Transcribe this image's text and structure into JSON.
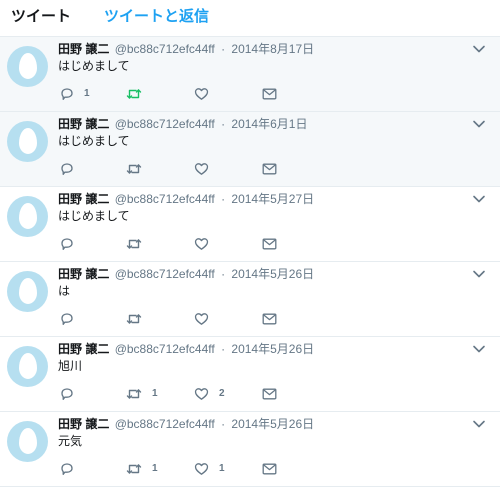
{
  "tabs": {
    "tweets": "ツイート",
    "tweets_replies": "ツイートと返信"
  },
  "colors": {
    "accent": "#1da1f2",
    "retweet_green": "#17bf63",
    "muted": "#657786",
    "highlight_bg": "#f5f8fa",
    "avatar_bg": "#b6dff0"
  },
  "icons": {
    "reply": "reply-icon",
    "retweet": "retweet-icon",
    "like": "heart-icon",
    "dm": "envelope-icon",
    "more": "chevron-down-icon",
    "avatar": "egg-avatar-icon"
  },
  "tweets": [
    {
      "name": "田野 譲二",
      "handle": "@bc88c712efc44ff",
      "sep": "·",
      "date": "2014年8月17日",
      "text": "はじめまして",
      "reply_count": "1",
      "retweet_count": "",
      "like_count": "",
      "highlighted": true,
      "retweeted": true
    },
    {
      "name": "田野 譲二",
      "handle": "@bc88c712efc44ff",
      "sep": "·",
      "date": "2014年6月1日",
      "text": "はじめまして",
      "reply_count": "",
      "retweet_count": "",
      "like_count": "",
      "highlighted": true,
      "retweeted": false
    },
    {
      "name": "田野 譲二",
      "handle": "@bc88c712efc44ff",
      "sep": "·",
      "date": "2014年5月27日",
      "text": "はじめまして",
      "reply_count": "",
      "retweet_count": "",
      "like_count": "",
      "highlighted": false,
      "retweeted": false
    },
    {
      "name": "田野 譲二",
      "handle": "@bc88c712efc44ff",
      "sep": "·",
      "date": "2014年5月26日",
      "text": "は",
      "reply_count": "",
      "retweet_count": "",
      "like_count": "",
      "highlighted": false,
      "retweeted": false
    },
    {
      "name": "田野 譲二",
      "handle": "@bc88c712efc44ff",
      "sep": "·",
      "date": "2014年5月26日",
      "text": "旭川",
      "reply_count": "",
      "retweet_count": "1",
      "like_count": "2",
      "highlighted": false,
      "retweeted": false
    },
    {
      "name": "田野 譲二",
      "handle": "@bc88c712efc44ff",
      "sep": "·",
      "date": "2014年5月26日",
      "text": "元気",
      "reply_count": "",
      "retweet_count": "1",
      "like_count": "1",
      "highlighted": false,
      "retweeted": false
    }
  ]
}
